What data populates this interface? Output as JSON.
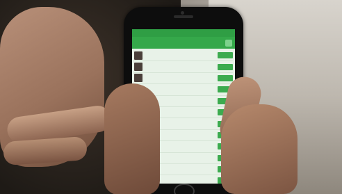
{
  "phone": {
    "status_left": "",
    "status_center": "",
    "status_right": "",
    "back_label": "",
    "title": "",
    "list": [
      {
        "name": "",
        "sub": "",
        "button": ""
      },
      {
        "name": "",
        "sub": "",
        "button": ""
      },
      {
        "name": "",
        "sub": "",
        "button": ""
      },
      {
        "name": "",
        "sub": "",
        "button": ""
      },
      {
        "name": "",
        "sub": "",
        "button": ""
      },
      {
        "name": "",
        "sub": "",
        "button": ""
      },
      {
        "name": "",
        "sub": "",
        "button": ""
      },
      {
        "name": "",
        "sub": "",
        "button": ""
      },
      {
        "name": "",
        "sub": "",
        "button": ""
      },
      {
        "name": "",
        "sub": "",
        "button": ""
      },
      {
        "name": "",
        "sub": "",
        "button": ""
      },
      {
        "name": "",
        "sub": "",
        "button": ""
      },
      {
        "name": "",
        "sub": "",
        "button": ""
      }
    ]
  },
  "colors": {
    "app_green": "#35a84a",
    "button_green": "#3cab4f",
    "screen_bg": "#e8f2e8"
  }
}
